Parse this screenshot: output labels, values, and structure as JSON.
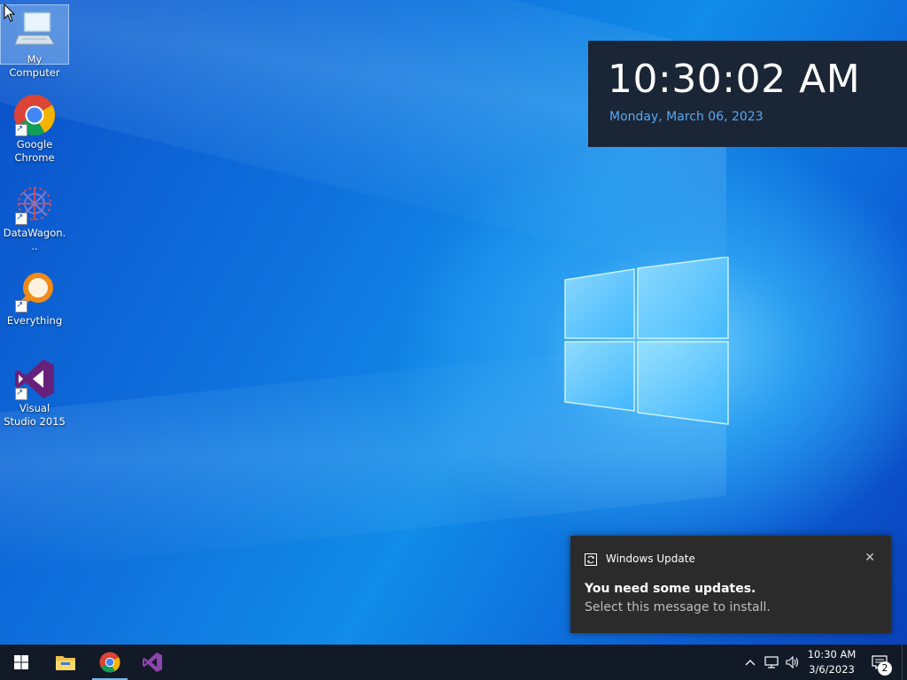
{
  "desktop": {
    "icons": [
      {
        "label": "My Computer",
        "icon": "computer-icon"
      },
      {
        "label": "Google Chrome",
        "icon": "chrome-icon"
      },
      {
        "label": "DataWagon...",
        "icon": "datawagon-icon"
      },
      {
        "label": "Everything",
        "icon": "everything-search-icon"
      },
      {
        "label": "Visual Studio 2015",
        "icon": "visual-studio-icon"
      }
    ]
  },
  "clock_widget": {
    "time": "10:30:02 AM",
    "date": "Monday, March 06, 2023"
  },
  "toast": {
    "app_name": "Windows Update",
    "title": "You need some updates.",
    "body": "Select this message to install.",
    "close_icon": "close-icon"
  },
  "taskbar": {
    "pinned": [
      {
        "icon": "windows-start-icon"
      },
      {
        "icon": "file-explorer-icon"
      },
      {
        "icon": "chrome-icon"
      },
      {
        "icon": "visual-studio-icon"
      }
    ],
    "tray": {
      "time": "10:30 AM",
      "date": "3/6/2023",
      "notification_count": "2"
    }
  },
  "colors": {
    "accent": "#0f73dd",
    "clock_bg": "#1a2536",
    "date_color": "#5aa8ee",
    "toast_bg": "#2b2b2b",
    "taskbar_bg": "#121a28"
  }
}
